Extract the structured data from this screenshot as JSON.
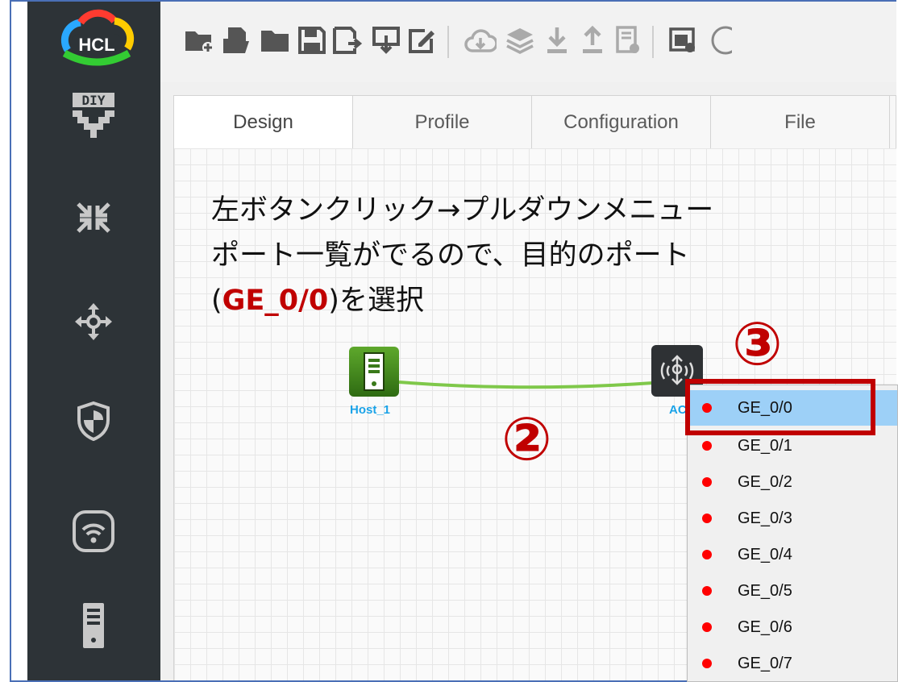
{
  "app": {
    "logo_text": "HCL"
  },
  "sidebar": {
    "items": [
      {
        "name": "diy",
        "icon": "diy-icon",
        "label": "DIY"
      },
      {
        "name": "routers",
        "icon": "router-arrows-icon"
      },
      {
        "name": "switches",
        "icon": "switch-arrows-icon"
      },
      {
        "name": "security",
        "icon": "shield-icon"
      },
      {
        "name": "wireless",
        "icon": "wireless-icon"
      },
      {
        "name": "hosts",
        "icon": "server-icon"
      }
    ]
  },
  "toolbar": {
    "icons": [
      "new-project-icon",
      "open-project-icon",
      "folder-icon",
      "save-icon",
      "save-as-icon",
      "import-icon",
      "edit-icon",
      "cloud-icon",
      "layers-icon",
      "download-icon",
      "upload-icon",
      "log-icon",
      "screenshot-icon"
    ]
  },
  "tabs": [
    {
      "label": "Design",
      "active": true
    },
    {
      "label": "Profile",
      "active": false
    },
    {
      "label": "Configuration",
      "active": false
    },
    {
      "label": "File",
      "active": false
    }
  ],
  "annotation": {
    "line1": "左ボタンクリック→プルダウンメニュー",
    "line2": "ポート一覧がでるので、目的のポート",
    "line3_prefix": "(",
    "line3_highlight": "GE_0/0",
    "line3_suffix": ")を選択",
    "step2": "②",
    "step3": "③"
  },
  "topology": {
    "host": {
      "label": "Host_1",
      "icon": "server-icon"
    },
    "ac": {
      "label": "AC_",
      "icon": "wireless-ac-icon"
    }
  },
  "port_menu": {
    "items": [
      {
        "label": "GE_0/0",
        "selected": true
      },
      {
        "label": "GE_0/1",
        "selected": false
      },
      {
        "label": "GE_0/2",
        "selected": false
      },
      {
        "label": "GE_0/3",
        "selected": false
      },
      {
        "label": "GE_0/4",
        "selected": false
      },
      {
        "label": "GE_0/5",
        "selected": false
      },
      {
        "label": "GE_0/6",
        "selected": false
      },
      {
        "label": "GE_0/7",
        "selected": false
      }
    ]
  },
  "colors": {
    "accent_red": "#c00000",
    "sidebar_bg": "#2d3337",
    "link_green": "#7fc84a",
    "node_label_blue": "#1aa3e8",
    "menu_selected": "#9dd0f7",
    "port_dot": "#ff0000"
  }
}
